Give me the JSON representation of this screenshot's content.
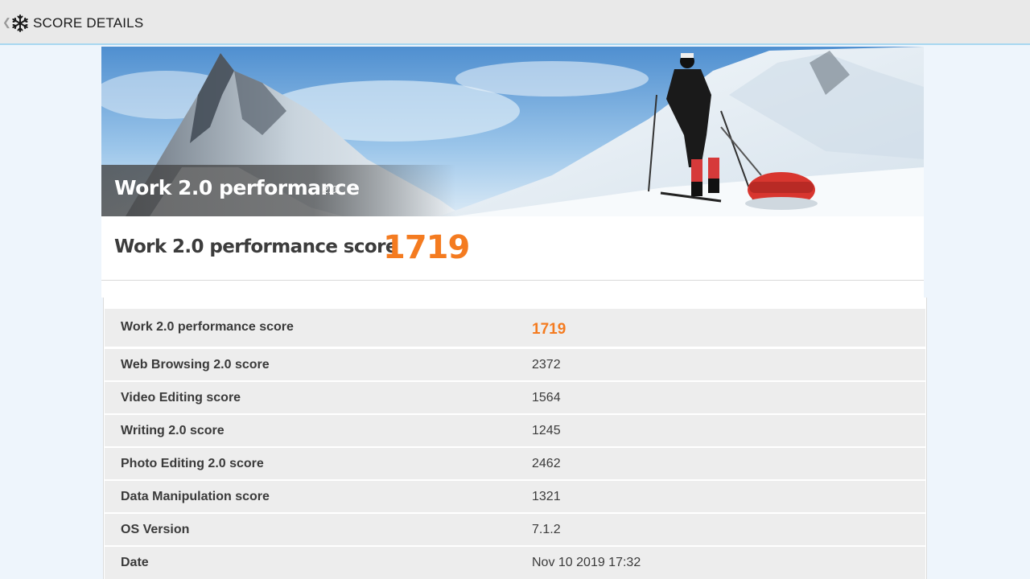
{
  "header": {
    "back_glyph": "❮",
    "icon": "snowflake-icon",
    "title": "SCORE DETAILS"
  },
  "hero": {
    "title": "Work 2.0 performance",
    "version": "2.0"
  },
  "summary": {
    "label": "Work 2.0 performance score",
    "value": "1719"
  },
  "colors": {
    "accent": "#f47b20",
    "topbar_border": "#a8d8f0",
    "row_bg": "#ededed"
  },
  "details": [
    {
      "label": "Work 2.0 performance score",
      "value": "1719"
    },
    {
      "label": "Web Browsing 2.0 score",
      "value": "2372"
    },
    {
      "label": "Video Editing score",
      "value": "1564"
    },
    {
      "label": "Writing 2.0 score",
      "value": "1245"
    },
    {
      "label": "Photo Editing 2.0 score",
      "value": "2462"
    },
    {
      "label": "Data Manipulation score",
      "value": "1321"
    },
    {
      "label": "OS Version",
      "value": "7.1.2"
    },
    {
      "label": "Date",
      "value": "Nov 10 2019 17:32"
    }
  ]
}
